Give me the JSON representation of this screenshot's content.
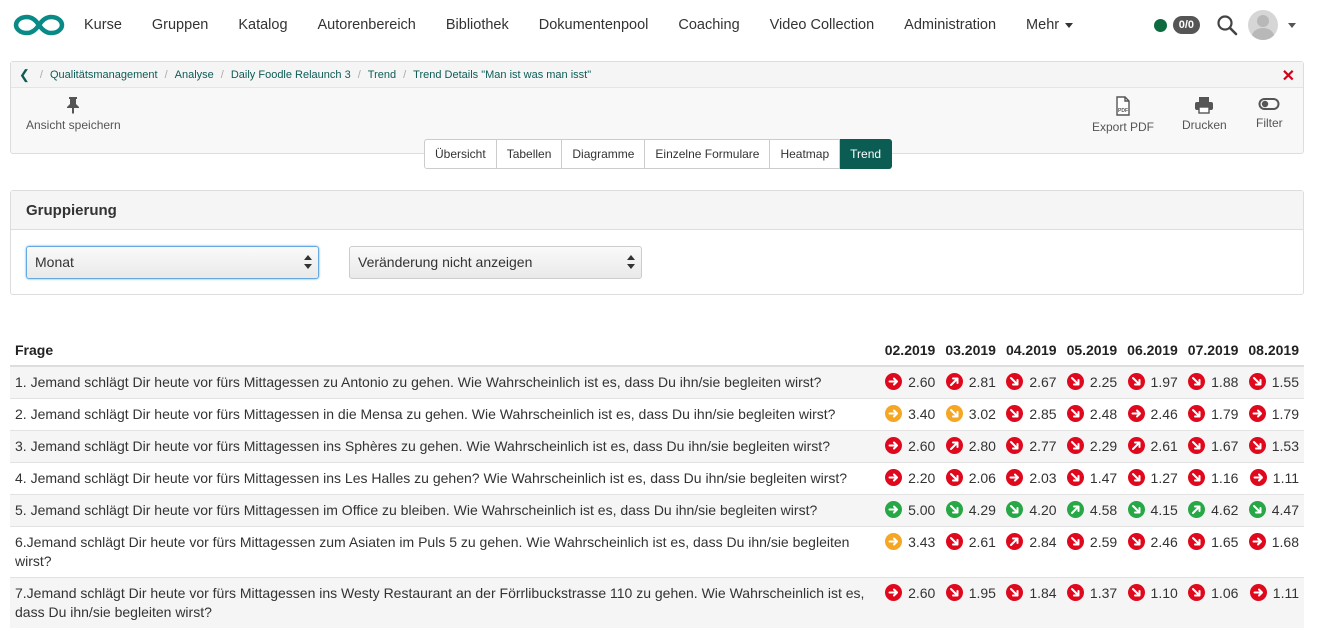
{
  "nav": {
    "items": [
      "Kurse",
      "Gruppen",
      "Katalog",
      "Autorenbereich",
      "Bibliothek",
      "Dokumentenpool",
      "Coaching",
      "Video Collection",
      "Administration",
      "Mehr"
    ],
    "badge": "0/0",
    "status_color": "#0e6b40",
    "logo_color": "#0a8a86"
  },
  "breadcrumb": [
    "Qualitätsmanagement",
    "Analyse",
    "Daily Foodle Relaunch 3",
    "Trend",
    "Trend Details \"Man ist was man isst\""
  ],
  "toolbar": {
    "save_view": "Ansicht speichern",
    "export_pdf": "Export PDF",
    "print": "Drucken",
    "filter": "Filter"
  },
  "tabs": [
    "Übersicht",
    "Tabellen",
    "Diagramme",
    "Einzelne Formulare",
    "Heatmap",
    "Trend"
  ],
  "active_tab": "Trend",
  "grouping": {
    "title": "Gruppierung",
    "select1": "Monat",
    "select2": "Veränderung nicht anzeigen"
  },
  "table": {
    "header_question": "Frage",
    "months": [
      "02.2019",
      "03.2019",
      "04.2019",
      "05.2019",
      "06.2019",
      "07.2019",
      "08.2019"
    ],
    "rows": [
      {
        "q": "1. Jemand schlägt Dir heute vor fürs Mittagessen zu Antonio zu gehen. Wie Wahrscheinlich ist es, dass Du ihn/sie begleiten wirst?",
        "cells": [
          [
            "red",
            "right",
            "2.60"
          ],
          [
            "red",
            "up",
            "2.81"
          ],
          [
            "red",
            "down",
            "2.67"
          ],
          [
            "red",
            "down",
            "2.25"
          ],
          [
            "red",
            "down",
            "1.97"
          ],
          [
            "red",
            "down",
            "1.88"
          ],
          [
            "red",
            "down",
            "1.55"
          ]
        ]
      },
      {
        "q": "2. Jemand schlägt Dir heute vor fürs Mittagessen in die Mensa zu gehen. Wie Wahrscheinlich ist es, dass Du ihn/sie begleiten wirst?",
        "cells": [
          [
            "orange",
            "right",
            "3.40"
          ],
          [
            "orange",
            "down",
            "3.02"
          ],
          [
            "red",
            "down",
            "2.85"
          ],
          [
            "red",
            "down",
            "2.48"
          ],
          [
            "red",
            "right",
            "2.46"
          ],
          [
            "red",
            "down",
            "1.79"
          ],
          [
            "red",
            "right",
            "1.79"
          ]
        ]
      },
      {
        "q": "3. Jemand schlägt Dir heute vor fürs Mittagessen ins Sphères zu gehen. Wie Wahrscheinlich ist es, dass Du ihn/sie begleiten wirst?",
        "cells": [
          [
            "red",
            "right",
            "2.60"
          ],
          [
            "red",
            "up",
            "2.80"
          ],
          [
            "red",
            "down",
            "2.77"
          ],
          [
            "red",
            "down",
            "2.29"
          ],
          [
            "red",
            "up",
            "2.61"
          ],
          [
            "red",
            "down",
            "1.67"
          ],
          [
            "red",
            "down",
            "1.53"
          ]
        ]
      },
      {
        "q": "4. Jemand schlägt Dir heute vor fürs Mittagessen ins Les Halles zu gehen? Wie Wahrscheinlich ist es, dass Du ihn/sie begleiten wirst?",
        "cells": [
          [
            "red",
            "right",
            "2.20"
          ],
          [
            "red",
            "down",
            "2.06"
          ],
          [
            "red",
            "right",
            "2.03"
          ],
          [
            "red",
            "down",
            "1.47"
          ],
          [
            "red",
            "down",
            "1.27"
          ],
          [
            "red",
            "down",
            "1.16"
          ],
          [
            "red",
            "right",
            "1.11"
          ]
        ]
      },
      {
        "q": "5. Jemand schlägt Dir heute vor fürs Mittagessen im Office zu bleiben. Wie Wahrscheinlich ist es, dass Du ihn/sie begleiten wirst?",
        "cells": [
          [
            "green",
            "right",
            "5.00"
          ],
          [
            "green",
            "down",
            "4.29"
          ],
          [
            "green",
            "down",
            "4.20"
          ],
          [
            "green",
            "up",
            "4.58"
          ],
          [
            "green",
            "down",
            "4.15"
          ],
          [
            "green",
            "up",
            "4.62"
          ],
          [
            "green",
            "down",
            "4.47"
          ]
        ]
      },
      {
        "q": "6.Jemand schlägt Dir heute vor fürs Mittagessen zum Asiaten im Puls 5 zu gehen. Wie Wahrscheinlich ist es, dass Du ihn/sie begleiten wirst?",
        "cells": [
          [
            "orange",
            "right",
            "3.43"
          ],
          [
            "red",
            "down",
            "2.61"
          ],
          [
            "red",
            "up",
            "2.84"
          ],
          [
            "red",
            "down",
            "2.59"
          ],
          [
            "red",
            "down",
            "2.46"
          ],
          [
            "red",
            "down",
            "1.65"
          ],
          [
            "red",
            "right",
            "1.68"
          ]
        ]
      },
      {
        "q": "7.Jemand schlägt Dir heute vor fürs Mittagessen ins Westy Restaurant an der Förrlibuckstrasse 110 zu gehen. Wie Wahrscheinlich ist es, dass Du ihn/sie begleiten wirst?",
        "cells": [
          [
            "red",
            "right",
            "2.60"
          ],
          [
            "red",
            "down",
            "1.95"
          ],
          [
            "red",
            "down",
            "1.84"
          ],
          [
            "red",
            "down",
            "1.37"
          ],
          [
            "red",
            "down",
            "1.10"
          ],
          [
            "red",
            "down",
            "1.06"
          ],
          [
            "red",
            "right",
            "1.11"
          ]
        ]
      }
    ]
  }
}
